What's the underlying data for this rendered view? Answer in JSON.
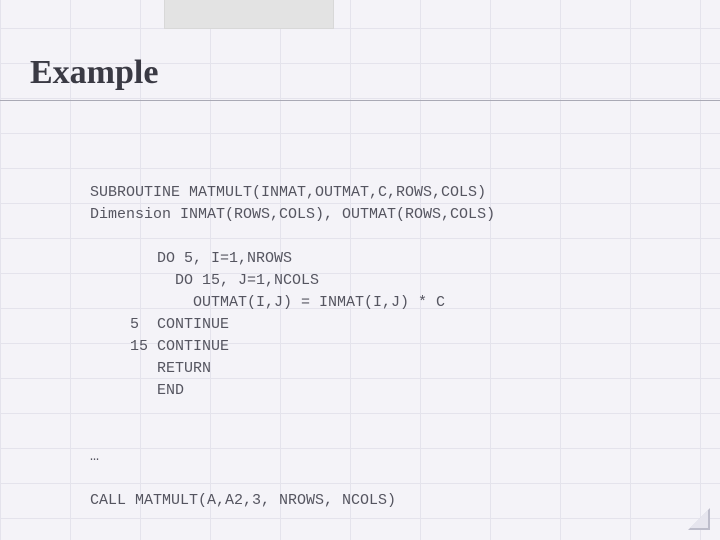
{
  "heading": "Example",
  "code": {
    "line1": "SUBROUTINE MATMULT(INMAT,OUTMAT,C,ROWS,COLS)",
    "line2": "Dimension INMAT(ROWS,COLS), OUTMAT(ROWS,COLS)",
    "blk1": "   DO 5, I=1,NROWS",
    "blk2": "     DO 15, J=1,NCOLS",
    "blk3": "       OUTMAT(I,J) = INMAT(I,J) * C",
    "blk4": "5  CONTINUE",
    "blk5": "15 CONTINUE",
    "blk6": "   RETURN",
    "blk7": "   END",
    "ellipsis": "…",
    "call": "CALL MATMULT(A,A2,3, NROWS, NCOLS)"
  }
}
